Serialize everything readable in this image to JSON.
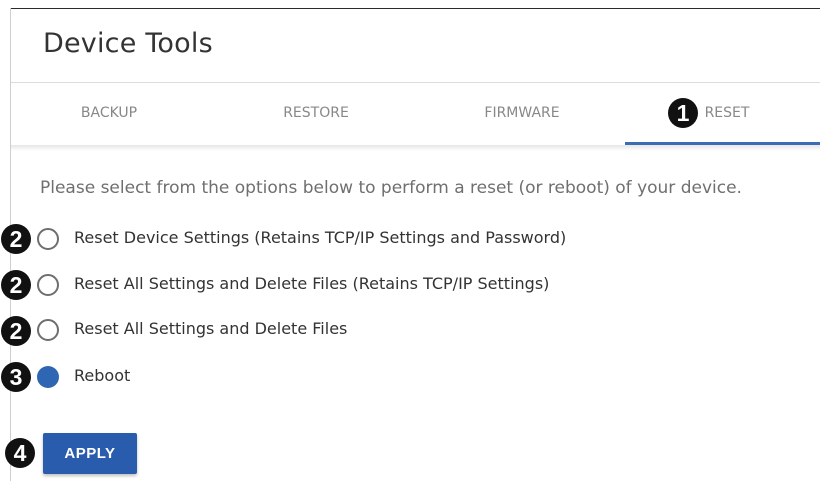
{
  "header": {
    "title": "Device Tools"
  },
  "tabs": [
    {
      "label": "BACKUP",
      "active": false
    },
    {
      "label": "RESTORE",
      "active": false
    },
    {
      "label": "FIRMWARE",
      "active": false
    },
    {
      "label": "RESET",
      "active": true
    }
  ],
  "main": {
    "intro_text": "Please select from the options below to perform a reset (or reboot) of your device.",
    "options": [
      {
        "label": "Reset Device Settings (Retains TCP/IP Settings and Password)",
        "selected": false
      },
      {
        "label": "Reset All Settings and Delete Files (Retains TCP/IP Settings)",
        "selected": false
      },
      {
        "label": "Reset All Settings and Delete Files",
        "selected": false
      },
      {
        "label": "Reboot",
        "selected": true
      }
    ],
    "apply_label": "APPLY"
  },
  "callouts": {
    "tab_reset": "1",
    "option_1": "2",
    "option_2": "2",
    "option_3": "2",
    "option_4": "3",
    "apply": "4"
  },
  "colors": {
    "accent": "#2a5cad",
    "tab_underline": "#3b6db5",
    "radio_selected": "#2f66b3",
    "callout": "#111111"
  }
}
